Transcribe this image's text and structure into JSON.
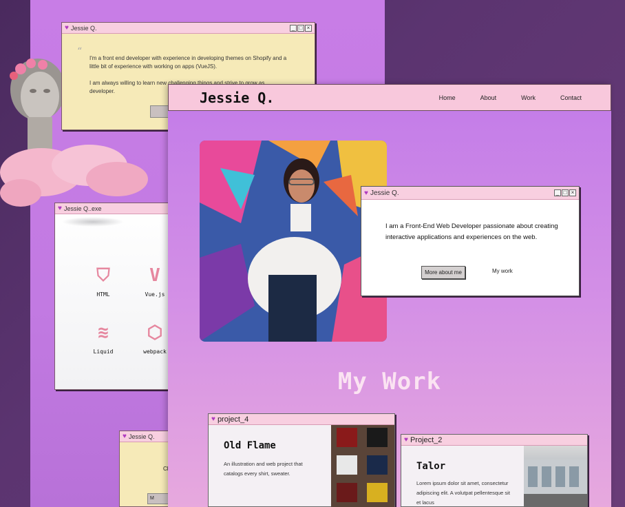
{
  "about_window": {
    "title": "Jessie Q.",
    "paragraph_1": "I'm a front end developer with experience in developing themes on Shopify and a little bit of experience with working on apps (VueJS).",
    "paragraph_2": "I am always willing to learn new challenging things and strive to grow as developer."
  },
  "skills_window": {
    "title": "Jessie Q..exe",
    "skills": [
      {
        "label": "HTML",
        "icon": "html5-icon"
      },
      {
        "label": "Vue.js",
        "icon": "vue-icon"
      },
      {
        "label": "Liquid",
        "icon": "liquid-icon"
      },
      {
        "label": "webpack",
        "icon": "webpack-icon"
      }
    ]
  },
  "small_window": {
    "title": "Jessie Q.",
    "text": "Ch",
    "button": "M"
  },
  "nav": {
    "brand": "Jessie Q.",
    "links": [
      "Home",
      "About",
      "Work",
      "Contact"
    ]
  },
  "intro_window": {
    "title": "Jessie Q.",
    "text": "I am a Front-End Web Developer passionate about creating interactive applications and experiences on the web.",
    "more_button": "More about me",
    "work_link": "My work"
  },
  "work_heading": "My Work",
  "projects": [
    {
      "window_title": "project_4",
      "name": "Old Flame",
      "desc": "An illustration and web project that catalogs every shirt, sweater."
    },
    {
      "window_title": "Project_2",
      "name": "Talor",
      "desc": "Lorem ipsum dolor sit amet, consectetur adipiscing elit. A volutpat pellentesque sit et lacus"
    }
  ],
  "colors": {
    "accent_pink": "#f8c8dc",
    "purple": "#c27be8",
    "yellow_window": "#f6eab8"
  }
}
